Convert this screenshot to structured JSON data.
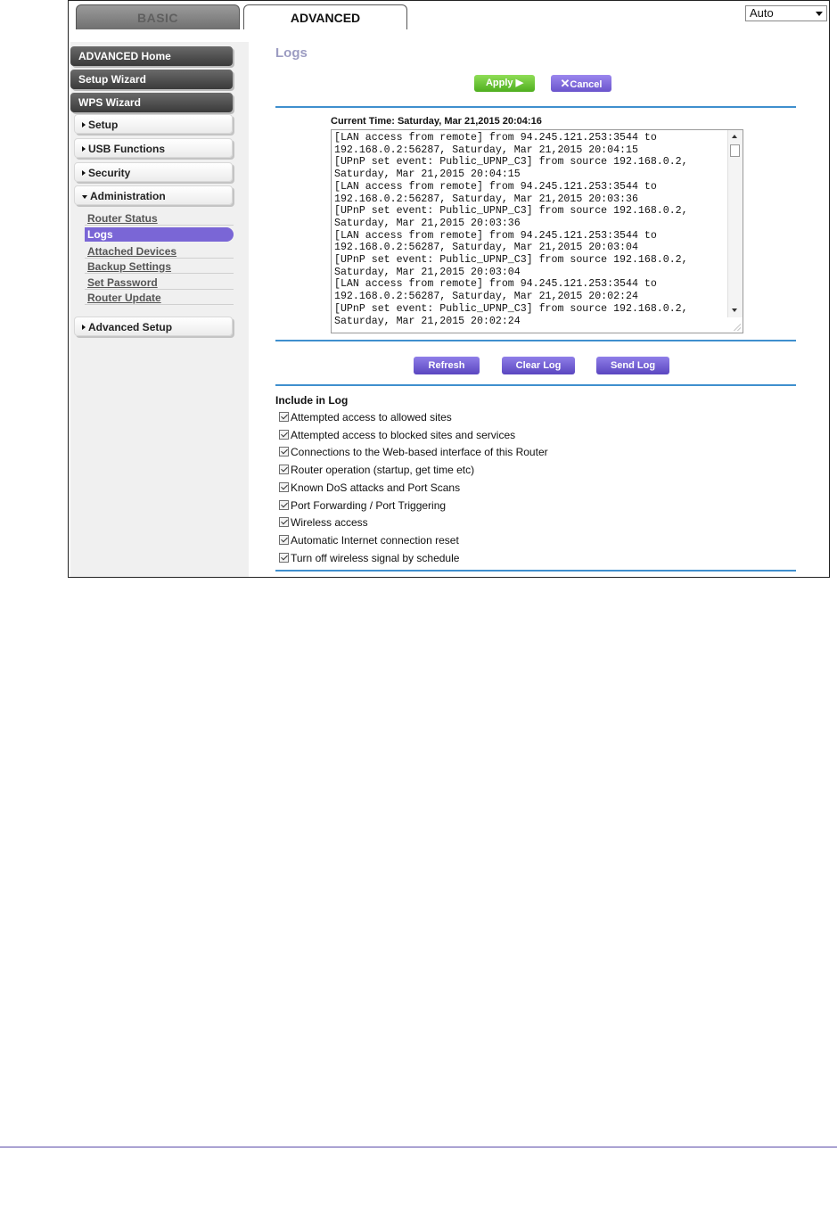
{
  "tabs": [
    {
      "label": "BASIC"
    },
    {
      "label": "ADVANCED"
    }
  ],
  "language_select": {
    "value": "Auto"
  },
  "sidebar": {
    "main_buttons": [
      {
        "label": "ADVANCED Home"
      },
      {
        "label": "Setup Wizard"
      },
      {
        "label": "WPS Wizard"
      }
    ],
    "sections": [
      {
        "label": "Setup"
      },
      {
        "label": "USB Functions"
      },
      {
        "label": "Security"
      },
      {
        "label": "Administration"
      }
    ],
    "admin_items": [
      {
        "label": "Router Status"
      },
      {
        "label": "Logs"
      },
      {
        "label": "Attached Devices"
      },
      {
        "label": "Backup Settings"
      },
      {
        "label": "Set Password"
      },
      {
        "label": "Router Update"
      }
    ],
    "advanced_setup": {
      "label": "Advanced Setup"
    }
  },
  "page": {
    "title": "Logs",
    "apply_label": "Apply",
    "cancel_label": "Cancel",
    "current_time": "Current Time: Saturday, Mar 21,2015 20:04:16",
    "log_lines": [
      "[LAN access from remote] from 94.245.121.253:3544 to",
      "192.168.0.2:56287, Saturday, Mar 21,2015 20:04:15",
      "[UPnP set event: Public_UPNP_C3] from source 192.168.0.2,",
      "Saturday, Mar 21,2015 20:04:15",
      "[LAN access from remote] from 94.245.121.253:3544 to",
      "192.168.0.2:56287, Saturday, Mar 21,2015 20:03:36",
      "[UPnP set event: Public_UPNP_C3] from source 192.168.0.2,",
      "Saturday, Mar 21,2015 20:03:36",
      "[LAN access from remote] from 94.245.121.253:3544 to",
      "192.168.0.2:56287, Saturday, Mar 21,2015 20:03:04",
      "[UPnP set event: Public_UPNP_C3] from source 192.168.0.2,",
      "Saturday, Mar 21,2015 20:03:04",
      "[LAN access from remote] from 94.245.121.253:3544 to",
      "192.168.0.2:56287, Saturday, Mar 21,2015 20:02:24",
      "[UPnP set event: Public_UPNP_C3] from source 192.168.0.2,",
      "Saturday, Mar 21,2015 20:02:24"
    ],
    "refresh_label": "Refresh",
    "clear_log_label": "Clear Log",
    "send_log_label": "Send Log",
    "include_title": "Include in Log",
    "include_options": [
      {
        "label": "Attempted access to allowed sites",
        "checked": true
      },
      {
        "label": "Attempted access to blocked sites and services",
        "checked": true
      },
      {
        "label": "Connections to the Web-based interface of this Router",
        "checked": true
      },
      {
        "label": "Router operation (startup, get time etc)",
        "checked": true
      },
      {
        "label": "Known DoS attacks and Port Scans",
        "checked": true
      },
      {
        "label": "Port Forwarding / Port Triggering",
        "checked": true
      },
      {
        "label": "Wireless access",
        "checked": true
      },
      {
        "label": "Automatic Internet connection reset",
        "checked": true
      },
      {
        "label": "Turn off wireless signal by schedule",
        "checked": true
      }
    ]
  },
  "colors": {
    "accent_purple": "#7a66d6",
    "apply_green": "#5fbf2a",
    "rule_blue": "#3f8fce"
  }
}
